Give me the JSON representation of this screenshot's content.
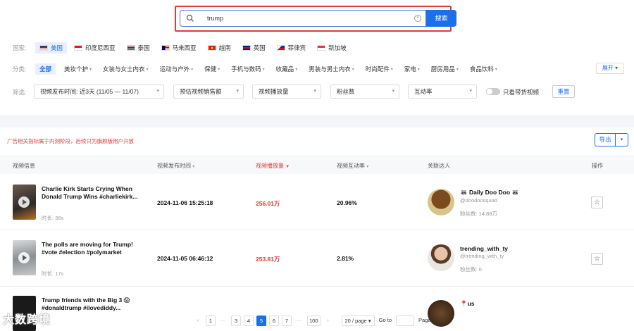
{
  "search": {
    "value": "trump",
    "button": "搜索"
  },
  "countries": {
    "label": "国家:",
    "items": [
      {
        "name": "美国",
        "active": true,
        "flag": "us"
      },
      {
        "name": "印度尼西亚",
        "active": false,
        "flag": "id"
      },
      {
        "name": "泰国",
        "active": false,
        "flag": "th"
      },
      {
        "name": "马来西亚",
        "active": false,
        "flag": "my"
      },
      {
        "name": "越南",
        "active": false,
        "flag": "vn"
      },
      {
        "name": "英国",
        "active": false,
        "flag": "gb"
      },
      {
        "name": "菲律宾",
        "active": false,
        "flag": "ph"
      },
      {
        "name": "新加坡",
        "active": false,
        "flag": "sg"
      }
    ]
  },
  "categories": {
    "label": "分类:",
    "items": [
      "全部",
      "美妆个护",
      "女装与女士内衣",
      "运动与户外",
      "保健",
      "手机与数码",
      "收藏品",
      "男装与男士内衣",
      "时尚配件",
      "家电",
      "厨房用品",
      "食品饮料"
    ],
    "expand": "展开"
  },
  "filters": {
    "label": "筛选:",
    "publish_time": "视频发布时间: 近3天 (11/05 — 11/07)",
    "sales": "预估视频销售额",
    "views": "视频播放量",
    "fans": "粉丝数",
    "engagement": "互动率",
    "toggle_label": "只看带货视频",
    "reset": "重置"
  },
  "notice": "广告相关指标属于内测阶段，后续只为旗舰版用户开放",
  "export": "导出",
  "table": {
    "headers": {
      "info": "视频信息",
      "time": "视频发布时间",
      "views": "视频播放量",
      "rate": "视频互动率",
      "creator": "关联达人",
      "action": "操作"
    },
    "rows": [
      {
        "title": "Charlie Kirk Starts Crying When Donald Trump Wins #charliekirk...",
        "duration": "时长: 36s",
        "time": "2024-11-06 15:25:18",
        "views": "256.01万",
        "rate": "20.96%",
        "creator": "🦝 Daily Doo Doo 🦝",
        "handle": "@doodoosquad",
        "fans": "粉丝数: 14.88万"
      },
      {
        "title": "The polls are moving for Trump! #vote #election #polymarket",
        "duration": "时长: 17s",
        "time": "2024-11-05 06:46:12",
        "views": "253.81万",
        "rate": "2.81%",
        "creator": "trending_with_ty",
        "handle": "@trending_with_ty",
        "fans": "粉丝数: 0"
      },
      {
        "title": "Trump friends with the Big 3 😱 #donaldtrump #ilovediddy...",
        "duration": "",
        "time": "",
        "views": "",
        "rate": "",
        "creator": "📍us",
        "handle": "",
        "fans": ""
      }
    ]
  },
  "pagination": {
    "pages": [
      "1",
      "3",
      "4",
      "5",
      "6",
      "7",
      "100"
    ],
    "current": "5",
    "per_page": "20 / page",
    "goto": "Go to",
    "page_suffix": "Page"
  },
  "watermark": "大数跨境",
  "colors": {
    "accent": "#1c6fe8",
    "danger": "#e03a3a"
  }
}
